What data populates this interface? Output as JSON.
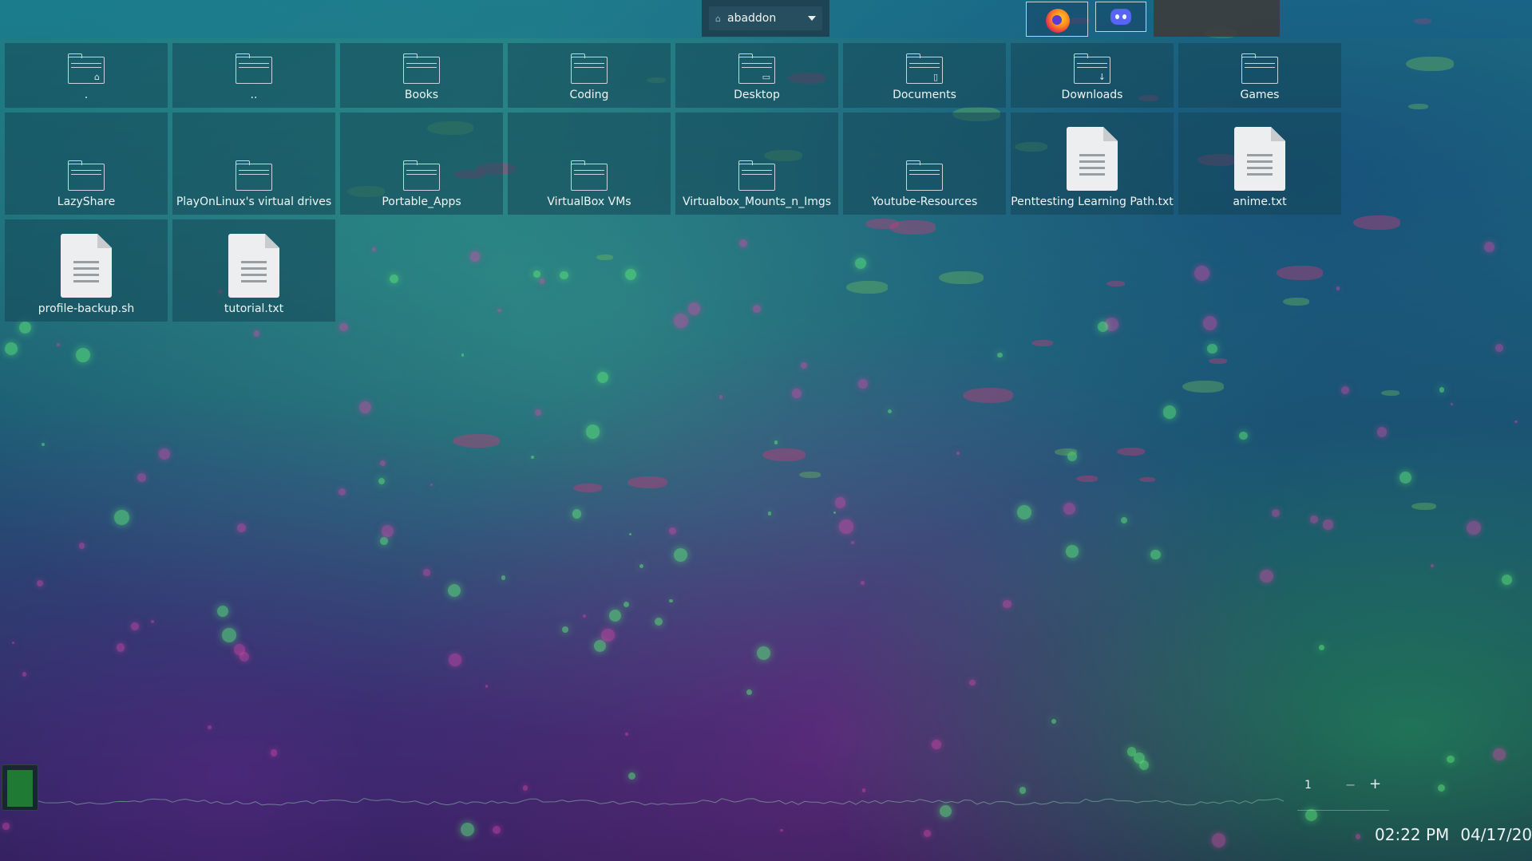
{
  "topbar": {
    "workspace_selector": {
      "value": "abaddon"
    },
    "taskbar_apps": [
      {
        "name": "firefox",
        "icon": "firefox-icon"
      },
      {
        "name": "discord",
        "icon": "discord-icon"
      }
    ]
  },
  "desktop": {
    "items": [
      {
        "label": ".",
        "kind": "folder",
        "emblem": "home"
      },
      {
        "label": "..",
        "kind": "folder",
        "emblem": ""
      },
      {
        "label": "Books",
        "kind": "folder",
        "emblem": ""
      },
      {
        "label": "Coding",
        "kind": "folder",
        "emblem": ""
      },
      {
        "label": "Desktop",
        "kind": "folder",
        "emblem": "desktop"
      },
      {
        "label": "Documents",
        "kind": "folder",
        "emblem": "document"
      },
      {
        "label": "Downloads",
        "kind": "folder",
        "emblem": "download"
      },
      {
        "label": "Games",
        "kind": "folder",
        "emblem": ""
      },
      {
        "label": "LazyShare",
        "kind": "folder",
        "emblem": ""
      },
      {
        "label": "PlayOnLinux's virtual drives",
        "kind": "folder",
        "emblem": ""
      },
      {
        "label": "Portable_Apps",
        "kind": "folder",
        "emblem": ""
      },
      {
        "label": "VirtualBox VMs",
        "kind": "folder",
        "emblem": ""
      },
      {
        "label": "Virtualbox_Mounts_n_Imgs",
        "kind": "folder",
        "emblem": ""
      },
      {
        "label": "Youtube-Resources",
        "kind": "folder",
        "emblem": ""
      },
      {
        "label": "Penttesting Learning Path.txt",
        "kind": "file"
      },
      {
        "label": "anime.txt",
        "kind": "file"
      },
      {
        "label": "profile-backup.sh",
        "kind": "file"
      },
      {
        "label": "tutorial.txt",
        "kind": "file"
      }
    ]
  },
  "bottom": {
    "pager": {
      "page": "1",
      "minus": "−",
      "plus": "+"
    },
    "clock": {
      "time": "02:22 PM",
      "date": "04/17/20"
    }
  },
  "colors": {
    "tile_bg": "#14465580",
    "accent_green": "#1f7a34",
    "text": "#eef5f5"
  }
}
